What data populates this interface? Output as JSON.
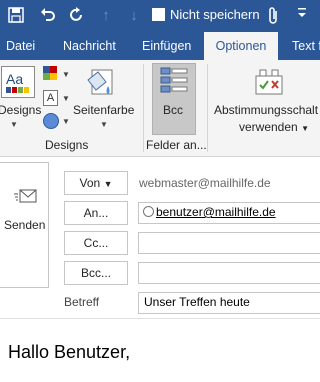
{
  "titlebar": {
    "no_save_label": "Nicht speichern",
    "no_save_checked": false
  },
  "tabs": [
    "Datei",
    "Nachricht",
    "Einfügen",
    "Optionen",
    "Text f"
  ],
  "active_tab": "Optionen",
  "ribbon": {
    "designs_label": "Designs",
    "page_color_label": "Seitenfarbe",
    "bcc_label": "Bcc",
    "vote_label_line1": "Abstimmungsschalt",
    "vote_label_line2": "verwenden",
    "group_designs": "Designs",
    "group_felder": "Felder an..."
  },
  "compose": {
    "send_label": "Senden",
    "from_button": "Von",
    "from_value": "webmaster@mailhilfe.de",
    "to_button": "An...",
    "to_value": "benutzer@mailhilfe.de",
    "cc_button": "Cc...",
    "bcc_button": "Bcc...",
    "subject_label": "Betreff",
    "subject_value": "Unser Treffen heute",
    "body": "Hallo Benutzer,"
  }
}
